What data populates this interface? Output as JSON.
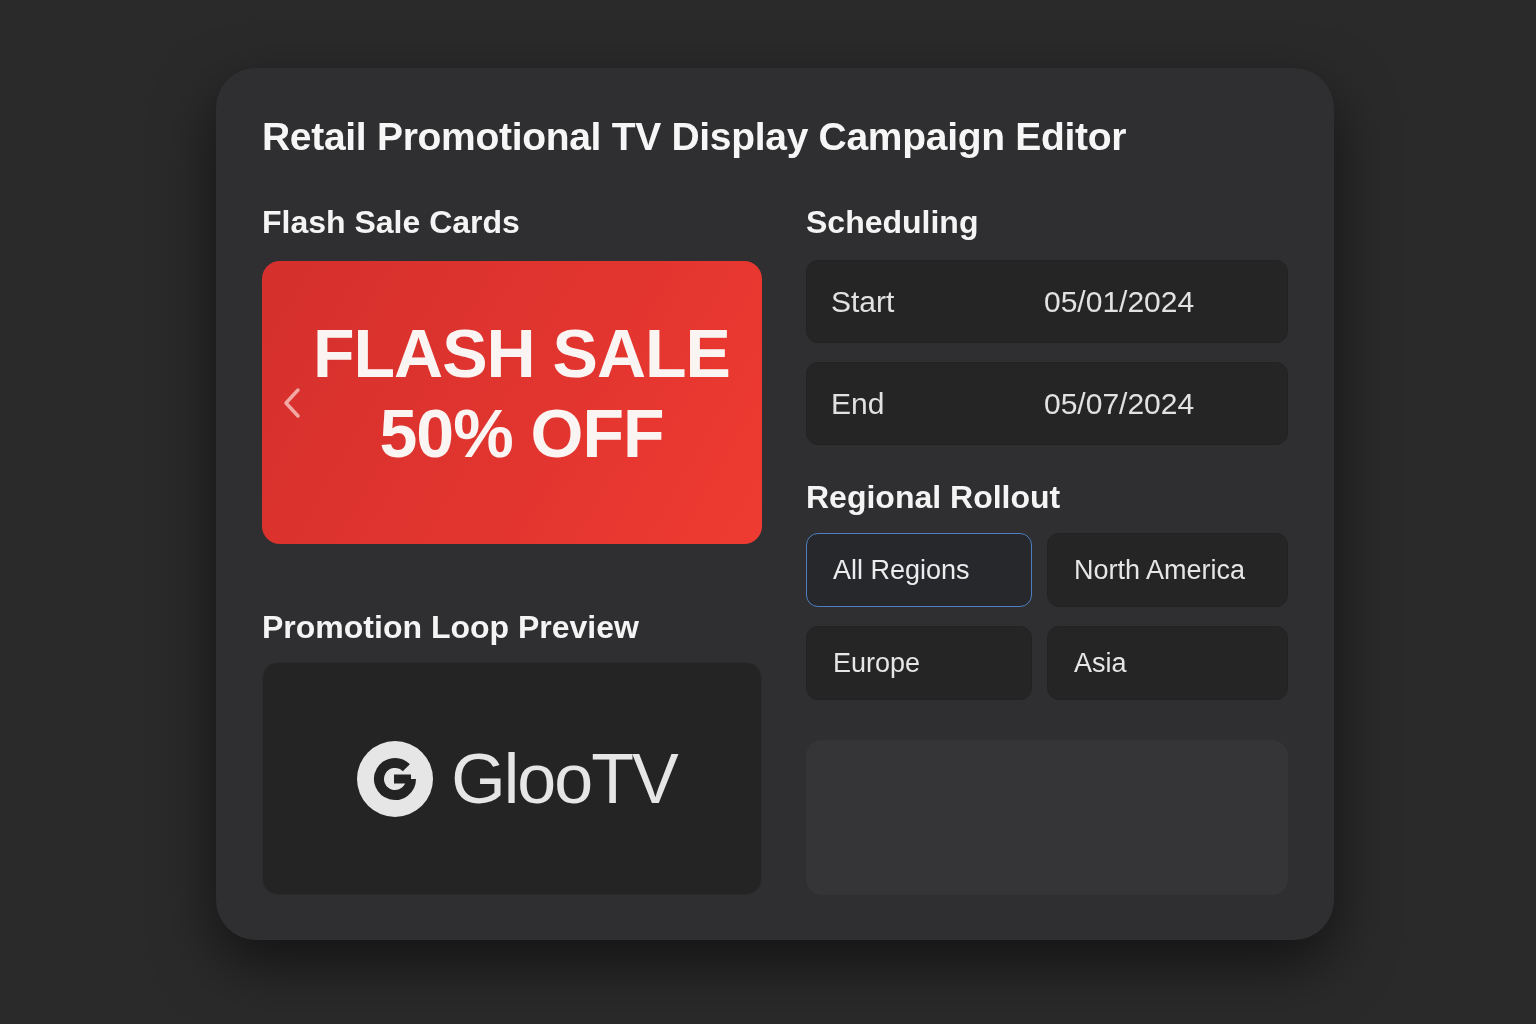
{
  "window": {
    "title": "Retail Promotional TV Display Campaign Editor"
  },
  "flash_sale_cards": {
    "heading": "Flash Sale Cards",
    "card": {
      "headline": "FLASH SALE",
      "offer": "50% OFF"
    }
  },
  "promotion_loop_preview": {
    "heading": "Promotion Loop Preview",
    "logo_text": "GlooTV"
  },
  "scheduling": {
    "heading": "Scheduling",
    "fields": [
      {
        "label": "Start",
        "value": "05/01/2024"
      },
      {
        "label": "End",
        "value": "05/07/2024"
      }
    ]
  },
  "regional_rollout": {
    "heading": "Regional Rollout",
    "regions": [
      {
        "label": "All Regions",
        "selected": true
      },
      {
        "label": "North America",
        "selected": false
      },
      {
        "label": "Europe",
        "selected": false
      },
      {
        "label": "Asia",
        "selected": false
      }
    ]
  }
}
